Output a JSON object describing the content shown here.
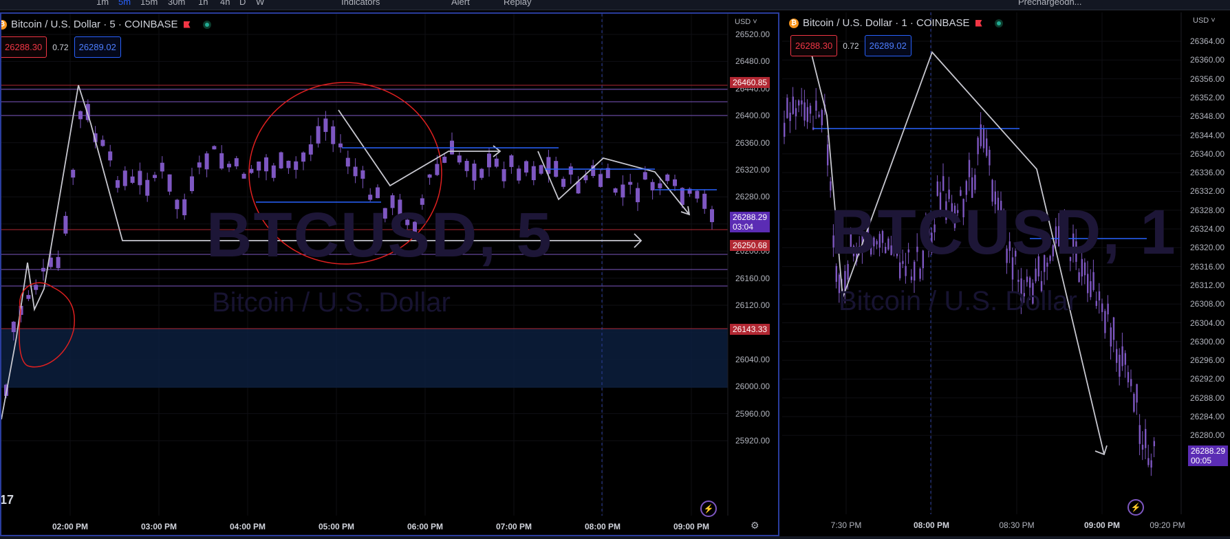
{
  "topbar": {
    "tf_1m": "1m",
    "tf_5m": "5m",
    "tf_15m": "15m",
    "tf_30m": "30m",
    "tf_1h": "1h",
    "tf_4h": "4h",
    "tf_1d": "D",
    "tf_1w": "W",
    "indicators_label": "Indicators",
    "alert_label": "Alert",
    "replay_label": "Replay",
    "layout_label": "Prechargeodn..."
  },
  "colors": {
    "candle": "#7e57c2",
    "accent_blue": "#2962ff",
    "sell_red": "#f23645",
    "live_green": "#22ab94",
    "zone_fill": "#0c1f3d"
  },
  "left_chart": {
    "title": "Bitcoin / U.S. Dollar · 5 · COINBASE",
    "sell_price": "26288.30",
    "spread": "0.72",
    "buy_price": "26289.02",
    "currency": "USD",
    "watermark_symbol": "BTCUSD, 5",
    "watermark_name": "Bitcoin / U.S. Dollar",
    "price_axis": [
      "26520.00",
      "26480.00",
      "26440.00",
      "26400.00",
      "26360.00",
      "26320.00",
      "26280.00",
      "26240.00",
      "26200.00",
      "26160.00",
      "26120.00",
      "26080.00",
      "26040.00",
      "26000.00",
      "25960.00",
      "25920.00"
    ],
    "price_tags": {
      "upper_red": "26460.85",
      "current": "26288.29",
      "countdown": "03:04",
      "lower_red": "26250.68",
      "zone_top": "26143.33"
    },
    "time_axis": [
      "02:00 PM",
      "03:00 PM",
      "04:00 PM",
      "05:00 PM",
      "06:00 PM",
      "07:00 PM",
      "08:00 PM",
      "09:00 PM"
    ],
    "logo": "17"
  },
  "right_chart": {
    "title": "Bitcoin / U.S. Dollar · 1 · COINBASE",
    "sell_price": "26288.30",
    "spread": "0.72",
    "buy_price": "26289.02",
    "currency": "USD",
    "watermark_symbol": "BTCUSD, 1",
    "watermark_name": "Bitcoin / U.S. Dollar",
    "price_axis": [
      "26364.00",
      "26360.00",
      "26356.00",
      "26352.00",
      "26348.00",
      "26344.00",
      "26340.00",
      "26336.00",
      "26332.00",
      "26328.00",
      "26324.00",
      "26320.00",
      "26316.00",
      "26312.00",
      "26308.00",
      "26304.00",
      "26300.00",
      "26296.00",
      "26292.00",
      "26288.00",
      "26284.00",
      "26280.00"
    ],
    "price_tags": {
      "current": "26288.29",
      "countdown": "00:05"
    },
    "time_axis": [
      "7:30 PM",
      "08:00 PM",
      "08:30 PM",
      "09:00 PM",
      "09:20 PM"
    ]
  }
}
